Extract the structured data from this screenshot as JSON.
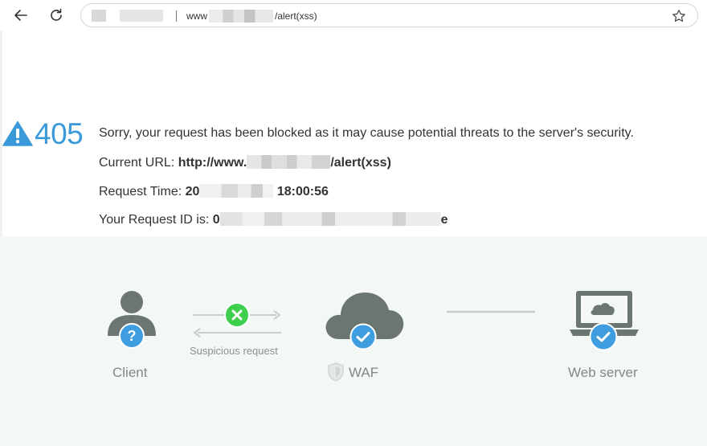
{
  "browser": {
    "url_prefix": "www",
    "url_suffix": "/alert(xss)",
    "back_icon": "arrow-left-icon",
    "reload_icon": "reload-icon",
    "bookmark_icon": "star-icon"
  },
  "error": {
    "code": "405",
    "message": "Sorry, your request has been blocked as it may cause potential threats to the server's security.",
    "url_label": "Current URL:",
    "url_prefix": "http://www.",
    "url_suffix": "/alert(xss)",
    "time_label": "Request Time:",
    "time_prefix": "20",
    "time_suffix": "18:00:56",
    "id_label": "Your Request ID is:",
    "id_prefix": "0",
    "id_suffix": "e"
  },
  "diagram": {
    "client_label": "Client",
    "arrow_label": "Suspicious request",
    "waf_label": "WAF",
    "server_label": "Web server",
    "colors": {
      "icon_gray": "#6b7671",
      "check_blue": "#3e9ee0",
      "block_green": "#3fcf4d",
      "accent_blue": "#3a9ad9"
    }
  }
}
